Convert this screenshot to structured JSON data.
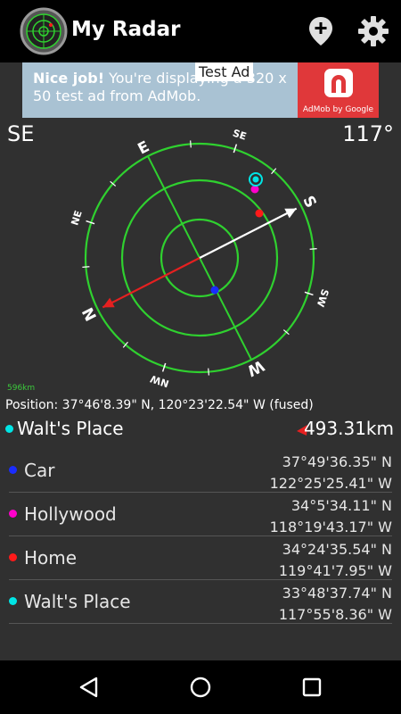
{
  "app": {
    "title": "My Radar"
  },
  "toolbar": {
    "add_place_icon": "map-pin-plus-icon",
    "settings_icon": "gear-icon"
  },
  "ad": {
    "bold": "Nice job!",
    "text": " You're displaying a 320 x 50 test ad from AdMob.",
    "badge": "Test Ad",
    "logo_label": "AdMob by Google"
  },
  "compass": {
    "heading_dir": "SE",
    "heading_deg": "117°",
    "scale": "596km",
    "labels": [
      "N",
      "NE",
      "E",
      "SE",
      "S",
      "SW",
      "W",
      "NW"
    ]
  },
  "position": "Position: 37°46'8.39\" N, 120°23'22.54\" W (fused)",
  "target": {
    "name": "Walt's Place",
    "distance": "493.31km",
    "color": "#00e5e5"
  },
  "places": [
    {
      "name": "Car",
      "lat": "37°49'36.35\" N",
      "lon": "122°25'25.41\" W",
      "color": "#1a2cff"
    },
    {
      "name": "Hollywood",
      "lat": "34°5'34.11\" N",
      "lon": "118°19'43.17\" W",
      "color": "#ff00cc"
    },
    {
      "name": "Home",
      "lat": "34°24'35.54\" N",
      "lon": "119°41'7.95\" W",
      "color": "#ff1a1a"
    },
    {
      "name": "Walt's Place",
      "lat": "33°48'37.74\" N",
      "lon": "117°55'8.36\" W",
      "color": "#00e5e5"
    }
  ],
  "colors": {
    "ring": "#2fd12f",
    "needle_north": "#e52020",
    "needle_south": "#ffffff"
  }
}
